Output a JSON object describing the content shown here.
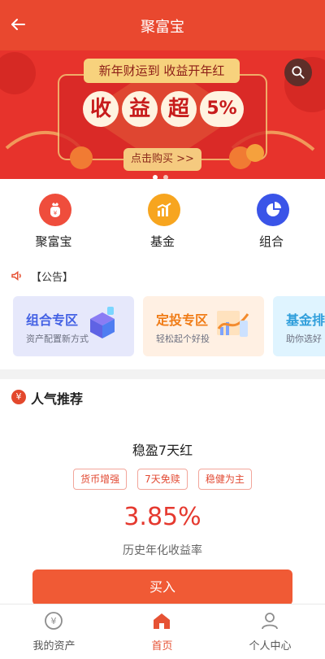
{
  "app": {
    "title": "聚富宝",
    "back_icon": "back-arrow-icon",
    "search_icon": "search-icon"
  },
  "banner": {
    "top_text": "新年财运到 收益开年红",
    "main_chars": [
      "收",
      "益",
      "超",
      "5%"
    ],
    "cta": "点击购买 >>",
    "page_count": 3,
    "active_page": 1,
    "colors": {
      "background": "#e7332c",
      "accent": "#f7d27d"
    }
  },
  "menu": {
    "items": [
      {
        "label": "聚富宝",
        "icon": "money-bag-icon"
      },
      {
        "label": "基金",
        "icon": "chart-bars-icon"
      },
      {
        "label": "组合",
        "icon": "pie-chart-icon"
      }
    ]
  },
  "notice": {
    "icon": "speaker-icon",
    "label": "【公告】"
  },
  "feature_cards": [
    {
      "title": "组合专区",
      "subtitle": "资产配置新方式",
      "icon": "portfolio-cube-icon"
    },
    {
      "title": "定投专区",
      "subtitle": "轻松起个好投",
      "icon": "investment-chart-icon"
    },
    {
      "title": "基金排",
      "subtitle": "助你选好",
      "icon": "ranking-icon"
    }
  ],
  "recommendation": {
    "title": "人气推荐",
    "icon_symbol": "¥",
    "product": {
      "name": "稳盈7天红",
      "tags": [
        "货币增强",
        "7天免赎",
        "稳健为主"
      ],
      "rate": "3.85%",
      "rate_label": "历史年化收益率",
      "buy_label": "买入"
    }
  },
  "tabs": [
    {
      "label": "我的资产",
      "icon": "yen-circle-icon",
      "active": false
    },
    {
      "label": "首页",
      "icon": "home-icon",
      "active": true
    },
    {
      "label": "个人中心",
      "icon": "user-icon",
      "active": false
    }
  ],
  "colors": {
    "primary": "#e9482f",
    "tab_active": "#e65234",
    "card_blue": "#4361e4",
    "card_orange": "#f07c17",
    "card_cyan": "#2f9edb"
  }
}
